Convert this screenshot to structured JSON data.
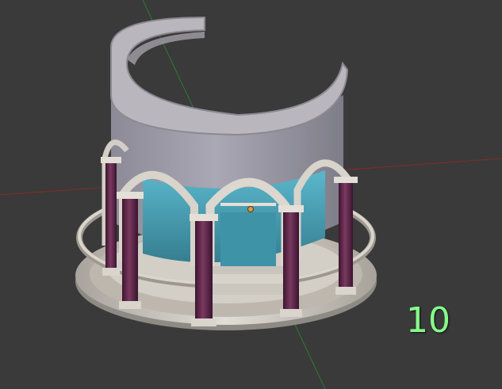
{
  "viewport": {
    "background": "#3a3a3a",
    "x_axis_color": "#8a2a2a",
    "y_axis_color": "#2f7a2f",
    "origin_color": "#e39a3a",
    "frame_number": "10",
    "frame_number_color": "#86ff8a"
  },
  "model": {
    "stone_color": "#c9c3bb",
    "glass_color": "#4fa4b8",
    "column_color": "#5c2445"
  }
}
